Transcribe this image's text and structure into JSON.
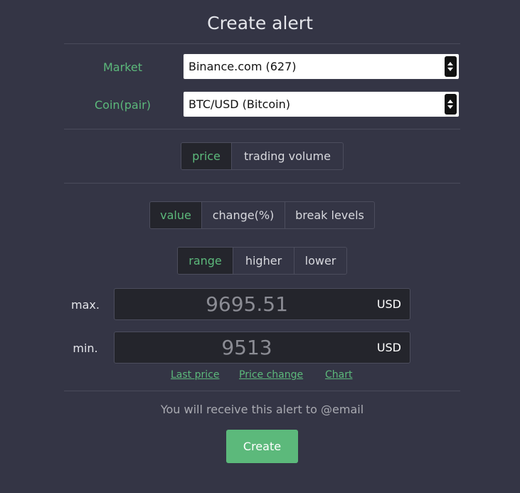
{
  "title": "Create alert",
  "market": {
    "label": "Market",
    "value": "Binance.com (627)"
  },
  "coin": {
    "label": "Coin(pair)",
    "value": "BTC/USD (Bitcoin)"
  },
  "metric_toggle": {
    "price": "price",
    "trading_volume": "trading volume",
    "selected": "price"
  },
  "type_toggle": {
    "value": "value",
    "change": "change(%)",
    "break_levels": "break levels",
    "selected": "value"
  },
  "condition_toggle": {
    "range": "range",
    "higher": "higher",
    "lower": "lower",
    "selected": "range"
  },
  "max": {
    "label": "max.",
    "value": "9695.51",
    "unit": "USD"
  },
  "min": {
    "label": "min.",
    "value": "9513",
    "unit": "USD"
  },
  "links": {
    "last_price": "Last price",
    "price_change": "Price change",
    "chart": "Chart"
  },
  "notice": "You will receive this alert to @email",
  "create_button": "Create",
  "colors": {
    "background": "#343545",
    "accent": "#5cb97b",
    "input_bg": "#24252c"
  }
}
